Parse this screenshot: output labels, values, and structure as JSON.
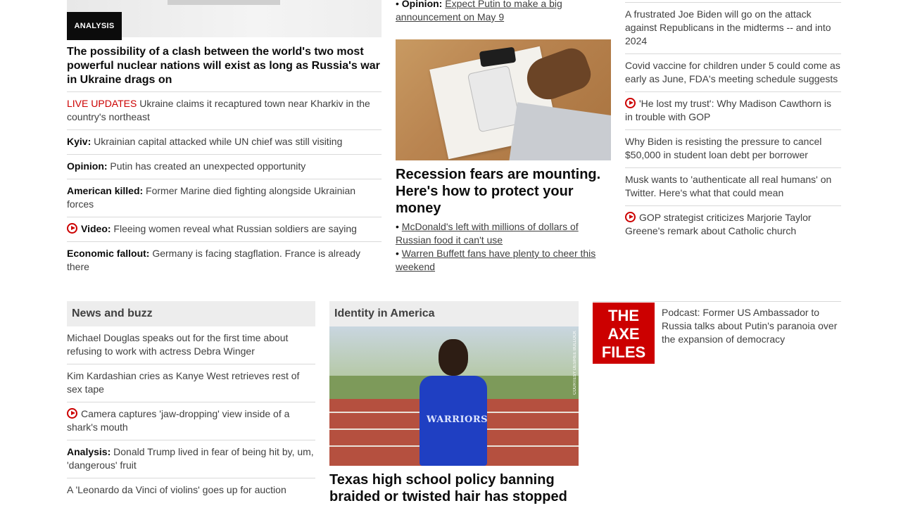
{
  "left": {
    "badge": "ANALYSIS",
    "headline": "The possibility of a clash between the world's two most powerful nuclear nations will exist as long as Russia's war in Ukraine drags on",
    "items": [
      {
        "kicker": "LIVE UPDATES",
        "text": " Ukraine claims it recaptured town near Kharkiv in the country's northeast",
        "type": "live"
      },
      {
        "kicker": "Kyiv:",
        "text": " Ukrainian capital attacked while UN chief was still visiting"
      },
      {
        "kicker": "Opinion:",
        "text": " Putin has created an unexpected opportunity"
      },
      {
        "kicker": "American killed:",
        "text": " Former Marine died fighting alongside Ukrainian forces"
      },
      {
        "kicker": "Video:",
        "text": " Fleeing women reveal what Russian soldiers are saying",
        "video": true
      },
      {
        "kicker": "Economic fallout:",
        "text": " Germany is facing stagflation. France is already there"
      }
    ]
  },
  "middle": {
    "top_bullet_kicker": "Opinion:",
    "top_bullet_text": "Expect Putin to make a big announcement on May 9",
    "headline": "Recession fears are mounting. Here's how to protect your money",
    "bullets": [
      "McDonald's left with millions of dollars of Russian food it can't use",
      "Warren Buffett fans have plenty to cheer this weekend"
    ]
  },
  "right": {
    "items": [
      {
        "text": "A frustrated Joe Biden will go on the attack against Republicans in the midterms -- and into 2024"
      },
      {
        "text": "Covid vaccine for children under 5 could come as early as June, FDA's meeting schedule suggests"
      },
      {
        "text": "'He lost my trust': Why Madison Cawthorn is in trouble with GOP",
        "video": true
      },
      {
        "text": "Why Biden is resisting the pressure to cancel $50,000 in student loan debt per borrower"
      },
      {
        "text": "Musk wants to 'authenticate all real humans' on Twitter. Here's what that could mean"
      },
      {
        "text": "GOP strategist criticizes Marjorie Taylor Greene's remark about Catholic church",
        "video": true
      }
    ]
  },
  "news": {
    "title": "News and buzz",
    "items": [
      {
        "text": "Michael Douglas speaks out for the first time about refusing to work with actress Debra Winger"
      },
      {
        "text": "Kim Kardashian cries as Kanye West retrieves rest of sex tape"
      },
      {
        "text": "Camera captures 'jaw-dropping' view inside of a shark's mouth",
        "video": true
      },
      {
        "kicker": "Analysis:",
        "text": " Donald Trump lived in fear of being hit by, um, 'dangerous' fruit"
      },
      {
        "text": "A 'Leonardo da Vinci of violins' goes up for auction"
      }
    ]
  },
  "identity": {
    "title": "Identity in America",
    "shirt": "WARRIORS",
    "credit": "COURTESY DESIREE BULLOCK",
    "headline": "Texas high school policy banning braided or twisted hair has stopped"
  },
  "axe": {
    "logo": [
      "THE",
      "AXE",
      "FILES"
    ],
    "text": "Podcast: Former US Ambassador to Russia talks about Putin's paranoia over the expansion of democracy"
  },
  "colors": {
    "accent": "#cc0000",
    "text": "#0c0c0c",
    "muted": "#404040",
    "rule": "#d9d9d9"
  }
}
